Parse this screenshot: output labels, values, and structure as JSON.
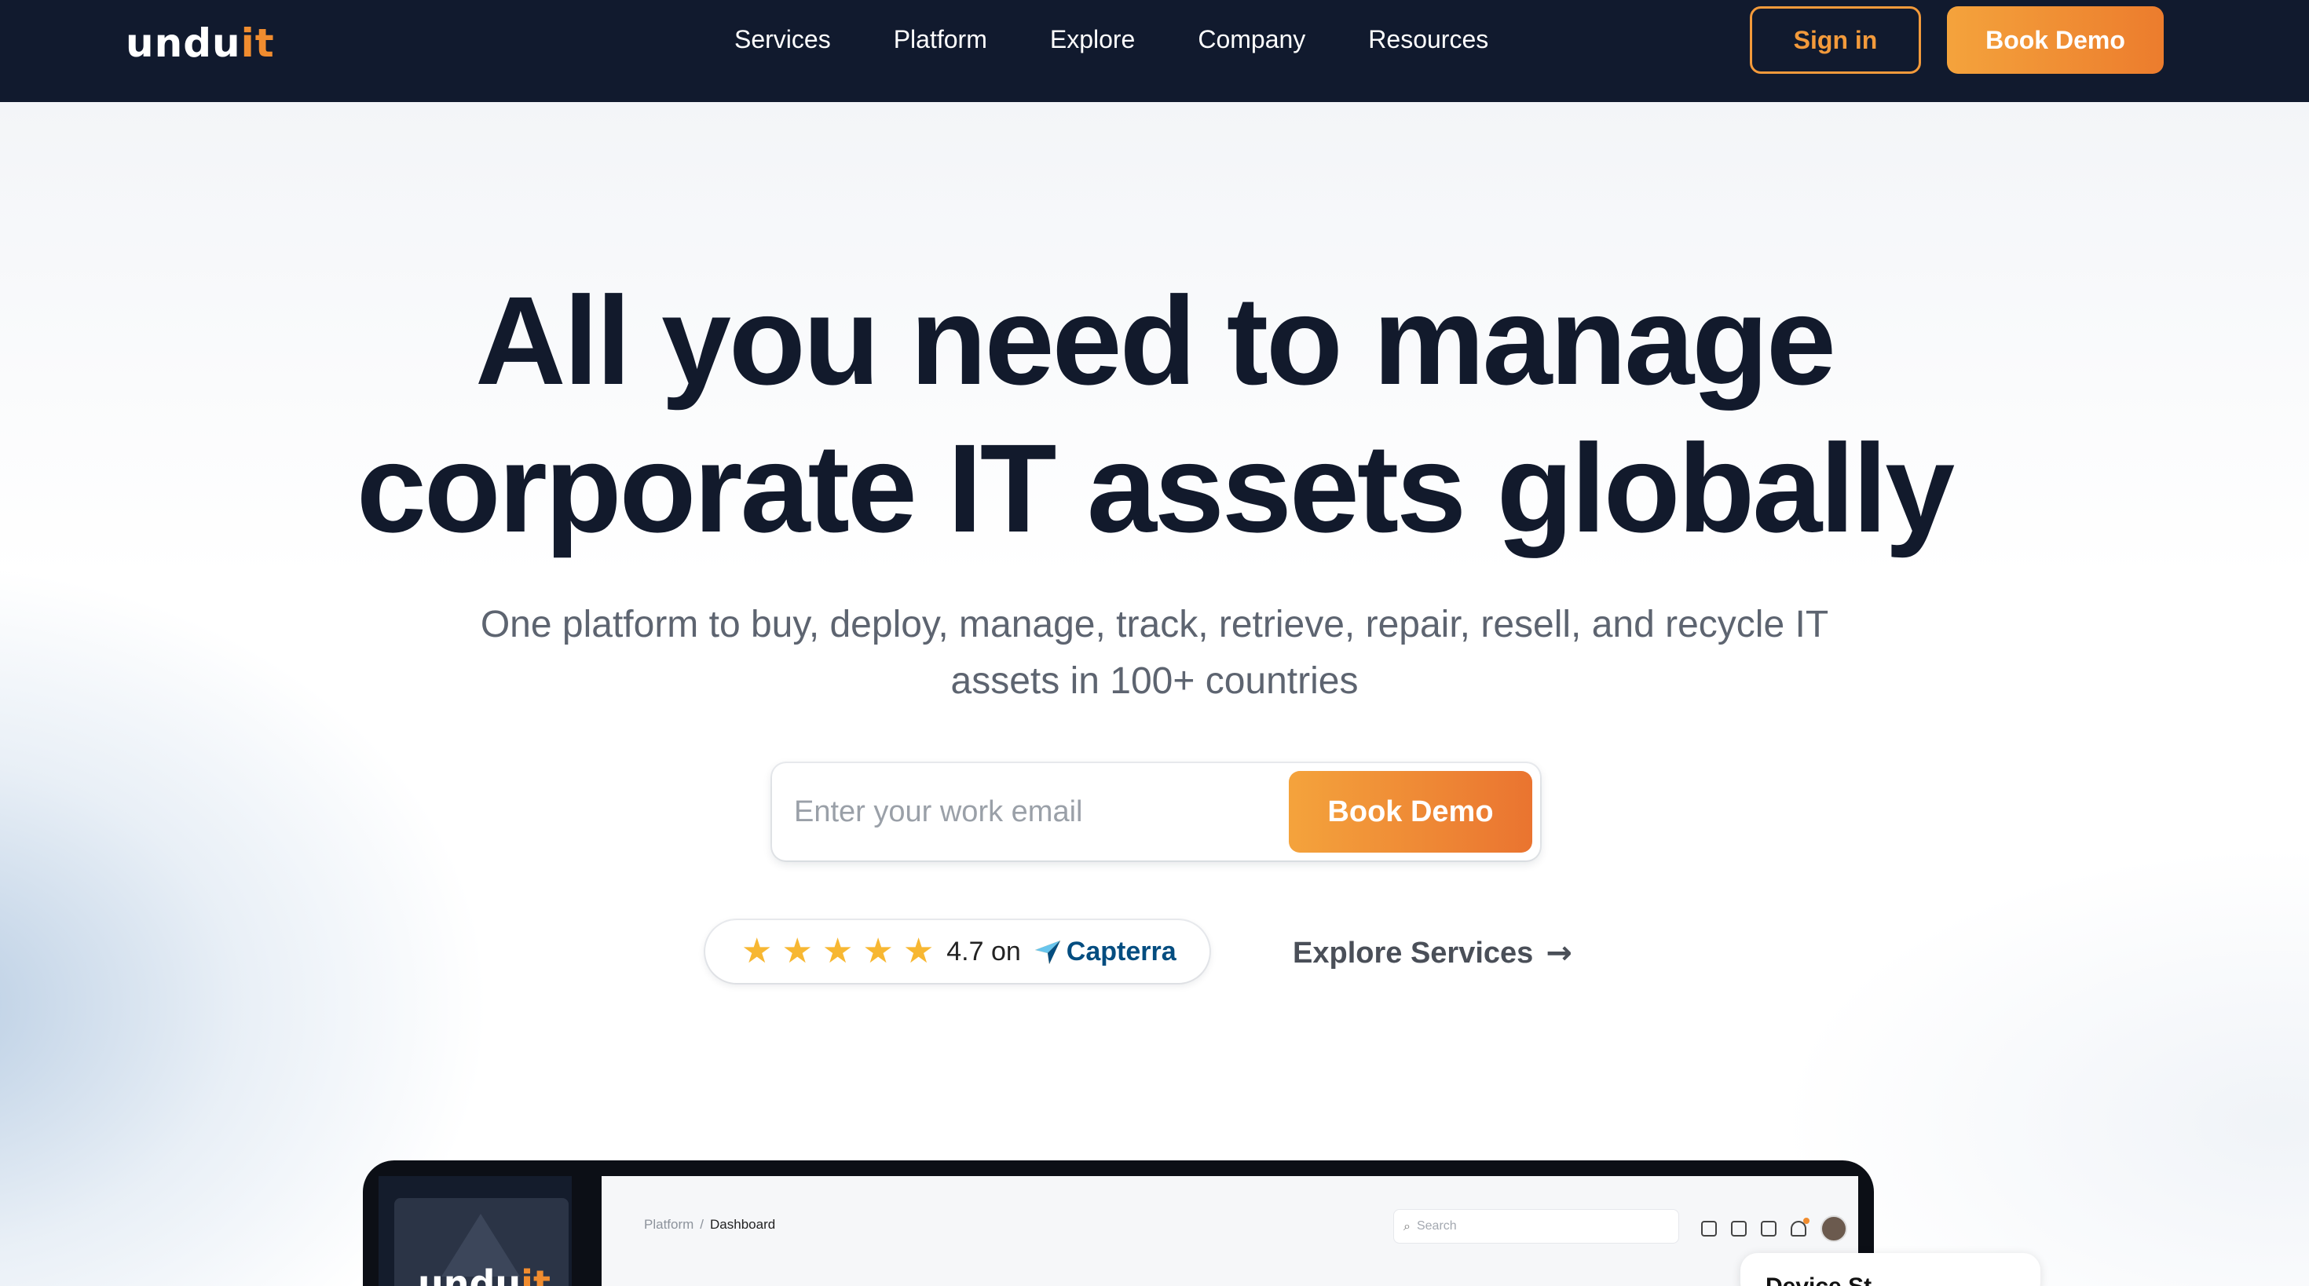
{
  "brand": {
    "name_main": "undu",
    "name_accent": "it",
    "accent_color": "#f08c2f",
    "nav_bg": "#111a2e"
  },
  "nav": {
    "links": [
      "Services",
      "Platform",
      "Explore",
      "Company",
      "Resources"
    ],
    "sign_in": "Sign in",
    "book_demo": "Book Demo"
  },
  "hero": {
    "headline_line1": "All you need to manage",
    "headline_line2": "corporate IT assets globally",
    "subhead": "One platform to buy, deploy, manage, track, retrieve, repair, resell, and recycle IT assets in 100+ countries"
  },
  "email_form": {
    "placeholder": "Enter your work email",
    "button": "Book Demo"
  },
  "rating": {
    "stars": 5,
    "star_glyphs": [
      "★",
      "★",
      "★",
      "★",
      "★"
    ],
    "score_text": "4.7 on",
    "platform": "Capterra"
  },
  "explore": {
    "label": "Explore Services",
    "arrow": "→"
  },
  "device": {
    "logo_main": "undu",
    "logo_accent": "it",
    "breadcrumb_root": "Platform",
    "breadcrumb_sep": "/",
    "breadcrumb_current": "Dashboard",
    "search_placeholder": "Search",
    "icons": [
      "grid-icon",
      "cart-icon",
      "wallet-icon",
      "bell-icon"
    ],
    "popup_text": "Device St"
  }
}
